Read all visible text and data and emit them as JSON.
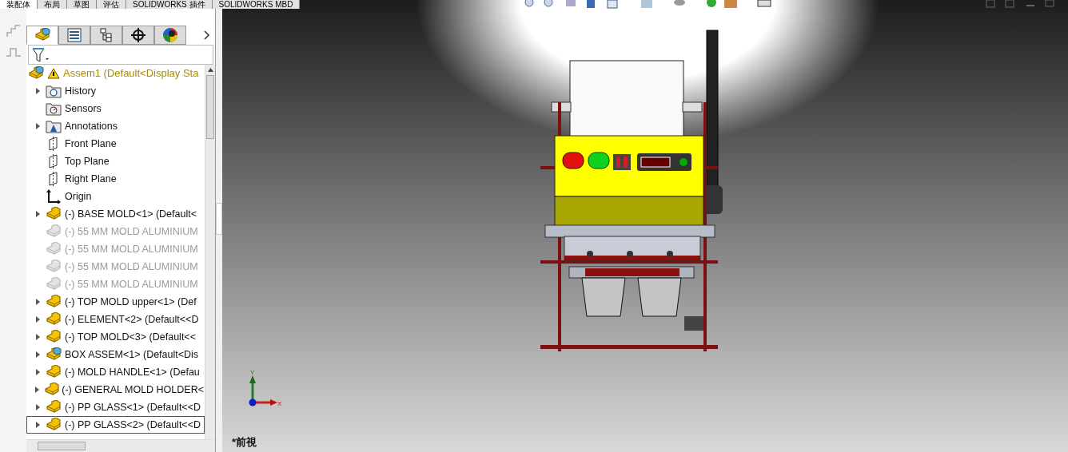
{
  "top_tabs": [
    {
      "label": "装配体",
      "selected": true
    },
    {
      "label": "布局",
      "selected": false
    },
    {
      "label": "草图",
      "selected": false
    },
    {
      "label": "评估",
      "selected": false
    },
    {
      "label": "SOLIDWORKS 插件",
      "selected": false
    },
    {
      "label": "SOLIDWORKS MBD",
      "selected": false
    }
  ],
  "panel_tabs": [
    {
      "kind": "tree",
      "selected": true
    },
    {
      "kind": "property",
      "selected": false
    },
    {
      "kind": "config",
      "selected": false
    },
    {
      "kind": "target",
      "selected": false
    },
    {
      "kind": "display",
      "selected": false
    }
  ],
  "tree": {
    "root": {
      "label": "Assem1  (Default<Display Sta",
      "warning": true
    },
    "items": [
      {
        "label": "History",
        "kind": "history",
        "expandable": true,
        "suppressed": false,
        "selected": false
      },
      {
        "label": "Sensors",
        "kind": "sensors",
        "expandable": false,
        "suppressed": false,
        "selected": false
      },
      {
        "label": "Annotations",
        "kind": "annotations",
        "expandable": true,
        "suppressed": false,
        "selected": false
      },
      {
        "label": "Front Plane",
        "kind": "plane",
        "expandable": false,
        "suppressed": false,
        "selected": false
      },
      {
        "label": "Top Plane",
        "kind": "plane",
        "expandable": false,
        "suppressed": false,
        "selected": false
      },
      {
        "label": "Right Plane",
        "kind": "plane",
        "expandable": false,
        "suppressed": false,
        "selected": false
      },
      {
        "label": "Origin",
        "kind": "origin",
        "expandable": false,
        "suppressed": false,
        "selected": false
      },
      {
        "label": "(-) BASE MOLD<1> (Default<",
        "kind": "part",
        "expandable": true,
        "suppressed": false,
        "selected": false
      },
      {
        "label": "(-) 55 MM MOLD ALUMINIUM",
        "kind": "part",
        "expandable": false,
        "suppressed": true,
        "selected": false
      },
      {
        "label": "(-) 55 MM MOLD ALUMINIUM",
        "kind": "part",
        "expandable": false,
        "suppressed": true,
        "selected": false
      },
      {
        "label": "(-) 55 MM MOLD ALUMINIUM",
        "kind": "part",
        "expandable": false,
        "suppressed": true,
        "selected": false
      },
      {
        "label": "(-) 55 MM MOLD ALUMINIUM",
        "kind": "part",
        "expandable": false,
        "suppressed": true,
        "selected": false
      },
      {
        "label": "(-) TOP MOLD upper<1> (Def",
        "kind": "part",
        "expandable": true,
        "suppressed": false,
        "selected": false
      },
      {
        "label": "(-) ELEMENT<2> (Default<<D",
        "kind": "part",
        "expandable": true,
        "suppressed": false,
        "selected": false
      },
      {
        "label": "(-) TOP MOLD<3> (Default<<",
        "kind": "part",
        "expandable": true,
        "suppressed": false,
        "selected": false
      },
      {
        "label": "BOX ASSEM<1> (Default<Dis",
        "kind": "assembly",
        "expandable": true,
        "suppressed": false,
        "selected": false
      },
      {
        "label": "(-) MOLD HANDLE<1> (Defau",
        "kind": "part",
        "expandable": true,
        "suppressed": false,
        "selected": false
      },
      {
        "label": "(-) GENERAL MOLD HOLDER<",
        "kind": "part",
        "expandable": true,
        "suppressed": false,
        "selected": false
      },
      {
        "label": "(-) PP GLASS<1> (Default<<D",
        "kind": "part",
        "expandable": true,
        "suppressed": false,
        "selected": false
      },
      {
        "label": "(-) PP GLASS<2> (Default<<D",
        "kind": "part",
        "expandable": true,
        "suppressed": false,
        "selected": true
      }
    ]
  },
  "triad": {
    "y_label": "Y",
    "x_label": "X"
  },
  "view_label": "*前視"
}
